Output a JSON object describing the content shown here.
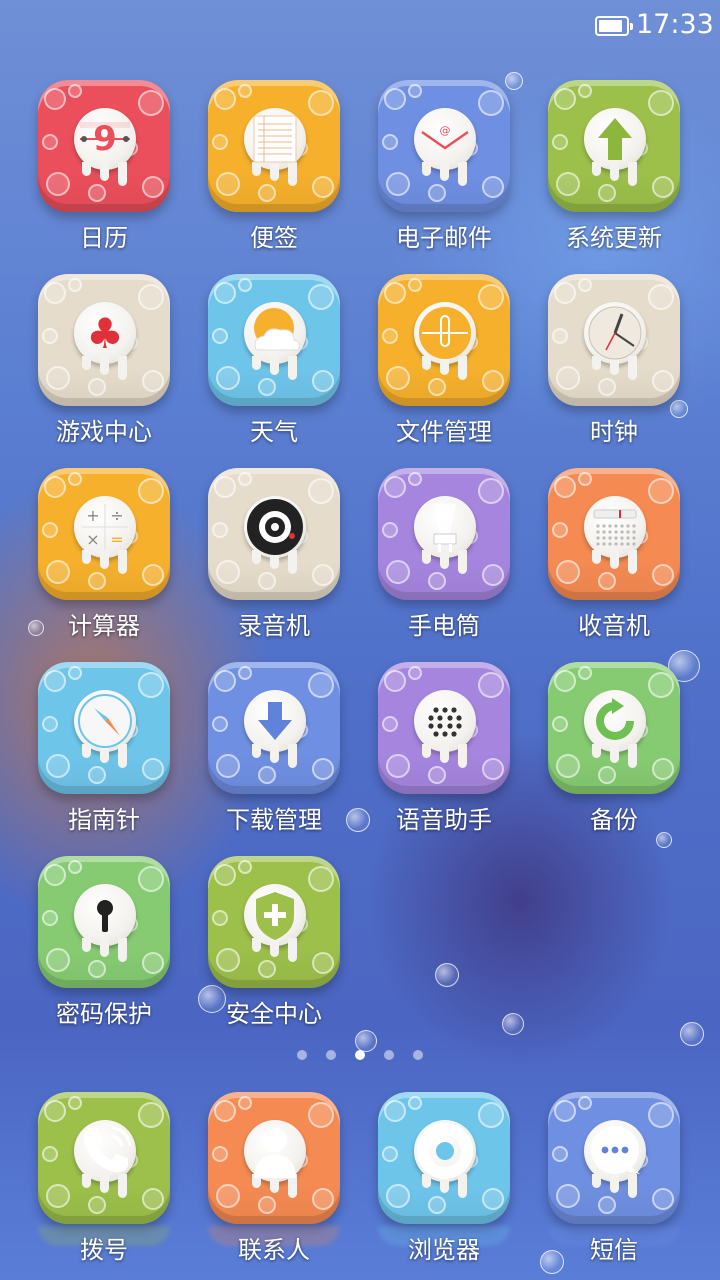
{
  "status_bar": {
    "time": "17:33",
    "battery_level": 0.9,
    "battery_icon": "battery-icon"
  },
  "colors": {
    "red": "#ea4f5b",
    "yellow": "#f6b02c",
    "blue": "#6f8fe2",
    "green": "#9cc04a",
    "cream": "#e6dccb",
    "sky": "#6ec5ea",
    "orange": "#f58a52",
    "purple": "#a585de",
    "light_green": "#86cb72"
  },
  "apps": [
    {
      "id": "calendar",
      "label": "日历",
      "icon": "calendar-icon",
      "color": "#ea4f5b",
      "glyph": "9"
    },
    {
      "id": "notes",
      "label": "便签",
      "icon": "notepad-icon",
      "color": "#f6b02c",
      "glyph": ""
    },
    {
      "id": "email",
      "label": "电子邮件",
      "icon": "envelope-icon",
      "color": "#6f8fe2",
      "glyph": "@"
    },
    {
      "id": "system-update",
      "label": "系统更新",
      "icon": "up-arrow-icon",
      "color": "#9cc04a",
      "glyph": ""
    },
    {
      "id": "game-center",
      "label": "游戏中心",
      "icon": "club-icon",
      "color": "#e6dccb",
      "glyph": "♣"
    },
    {
      "id": "weather",
      "label": "天气",
      "icon": "sun-cloud-icon",
      "color": "#6ec5ea",
      "glyph": ""
    },
    {
      "id": "file-manager",
      "label": "文件管理",
      "icon": "folder-icon",
      "color": "#f6b02c",
      "glyph": ""
    },
    {
      "id": "clock",
      "label": "时钟",
      "icon": "clock-icon",
      "color": "#e6dccb",
      "glyph": ""
    },
    {
      "id": "calculator",
      "label": "计算器",
      "icon": "calculator-icon",
      "color": "#f6b02c",
      "glyph": ""
    },
    {
      "id": "recorder",
      "label": "录音机",
      "icon": "microphone-icon",
      "color": "#e6dccb",
      "glyph": ""
    },
    {
      "id": "flashlight",
      "label": "手电筒",
      "icon": "flashlight-icon",
      "color": "#a585de",
      "glyph": ""
    },
    {
      "id": "radio",
      "label": "收音机",
      "icon": "radio-icon",
      "color": "#f58a52",
      "glyph": ""
    },
    {
      "id": "compass",
      "label": "指南针",
      "icon": "compass-icon",
      "color": "#6ec5ea",
      "glyph": ""
    },
    {
      "id": "download-manager",
      "label": "下载管理",
      "icon": "download-icon",
      "color": "#6f8fe2",
      "glyph": ""
    },
    {
      "id": "voice-assistant",
      "label": "语音助手",
      "icon": "speaker-icon",
      "color": "#a585de",
      "glyph": ""
    },
    {
      "id": "backup",
      "label": "备份",
      "icon": "backup-icon",
      "color": "#86cb72",
      "glyph": ""
    },
    {
      "id": "password-protect",
      "label": "密码保护",
      "icon": "keyhole-icon",
      "color": "#86cb72",
      "glyph": ""
    },
    {
      "id": "security-center",
      "label": "安全中心",
      "icon": "shield-icon",
      "color": "#9cc04a",
      "glyph": ""
    }
  ],
  "page_indicator": {
    "count": 5,
    "active": 2
  },
  "dock": [
    {
      "id": "dialer",
      "label": "拨号",
      "icon": "phone-icon",
      "color": "#9cc04a"
    },
    {
      "id": "contacts",
      "label": "联系人",
      "icon": "person-icon",
      "color": "#f58a52"
    },
    {
      "id": "browser",
      "label": "浏览器",
      "icon": "browser-ring-icon",
      "color": "#6ec5ea"
    },
    {
      "id": "messages",
      "label": "短信",
      "icon": "chat-bubble-icon",
      "color": "#6f8fe2"
    }
  ]
}
